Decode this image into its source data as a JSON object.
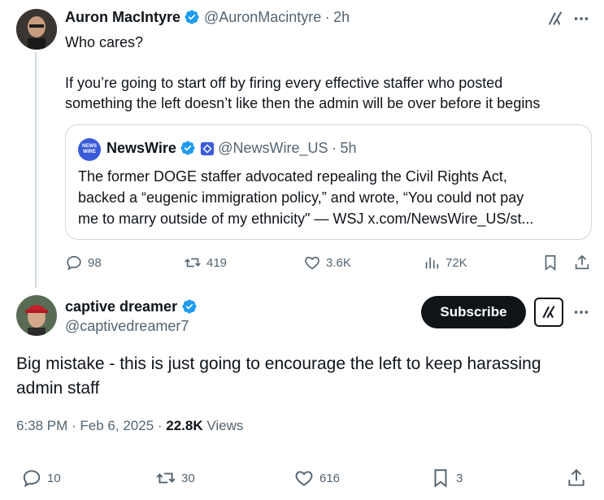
{
  "tweet1": {
    "name": "Auron MacIntyre",
    "handle": "@AuronMacintyre",
    "sep": "·",
    "time": "2h",
    "line1": "Who cares?",
    "line2": "If you’re going to start off by firing every effective staffer who posted",
    "line3": "something the left doesn’t like then the admin will be over before it begins",
    "quote": {
      "logo_text_top": "NEWS",
      "logo_text_bottom": "WIRE",
      "name": "NewsWire",
      "handle": "@NewsWire_US",
      "sep": "·",
      "time": "5h",
      "line1": "The former DOGE staffer advocated repealing the Civil Rights Act,",
      "line2": "backed a “eugenic immigration policy,” and wrote, “You could not pay",
      "line3": "me to marry outside of my ethnicity\" — WSJ x.com/NewsWire_US/st..."
    },
    "actions": {
      "replies": "98",
      "reposts": "419",
      "likes": "3.6K",
      "views": "72K"
    }
  },
  "tweet2": {
    "name": "captive dreamer",
    "handle": "@captivedreamer7",
    "subscribe_label": "Subscribe",
    "line1": "Big mistake - this is just going to encourage the left to keep harassing",
    "line2": "admin staff",
    "timestamp": "6:38 PM · Feb 6, 2025 · ",
    "views_count": "22.8K",
    "views_label": " Views",
    "actions": {
      "replies": "10",
      "reposts": "30",
      "likes": "616",
      "bookmarks": "3"
    }
  },
  "colors": {
    "text": "#0f1419",
    "muted": "#536471",
    "verified": "#1d9bf0",
    "border": "#cfd9de"
  },
  "icons": [
    "verified-badge-icon",
    "grok-icon",
    "more-icon",
    "reply-icon",
    "repost-icon",
    "like-icon",
    "views-icon",
    "bookmark-icon",
    "share-icon",
    "affiliate-badge-icon"
  ]
}
